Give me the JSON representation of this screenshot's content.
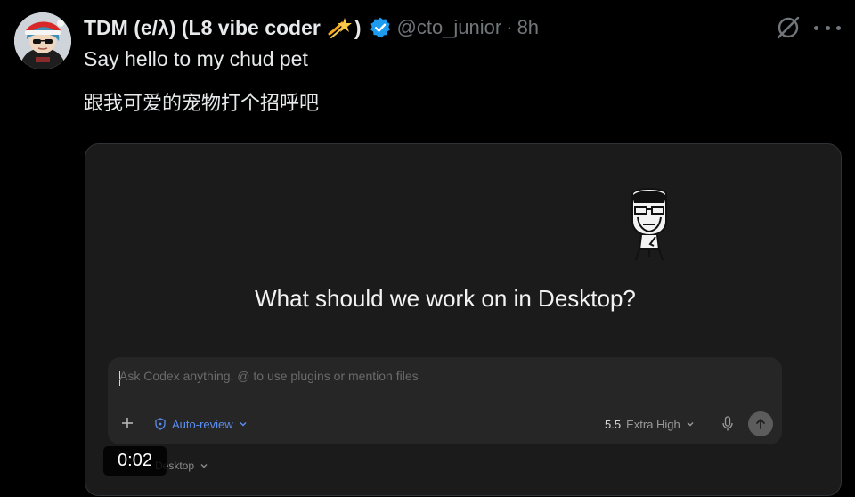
{
  "tweet": {
    "display_name": "TDM (e/λ) (L8 vibe coder",
    "display_name_close": ")",
    "emoji_icon": "shooting-star-emoji",
    "verified_icon": "verified-badge-icon",
    "handle": "@cto_junior",
    "separator": "·",
    "time": "8h",
    "text": "Say hello to my chud pet",
    "text_cn": "跟我可爱的宠物打个招呼吧"
  },
  "media": {
    "headline": "What should we work on in Desktop?",
    "composer": {
      "placeholder": "Ask Codex anything. @ to use plugins or mention files",
      "value": "",
      "auto_review_label": "Auto-review",
      "model_version": "5.5",
      "model_effort": "Extra High",
      "desktop_label": "Desktop"
    },
    "video_time": "0:02"
  },
  "colors": {
    "background": "#000000",
    "card": "#1b1b1b",
    "composer": "#262626",
    "accent_blue": "#5b8ef0",
    "verified": "#1d9bf0",
    "muted": "#71767b"
  }
}
